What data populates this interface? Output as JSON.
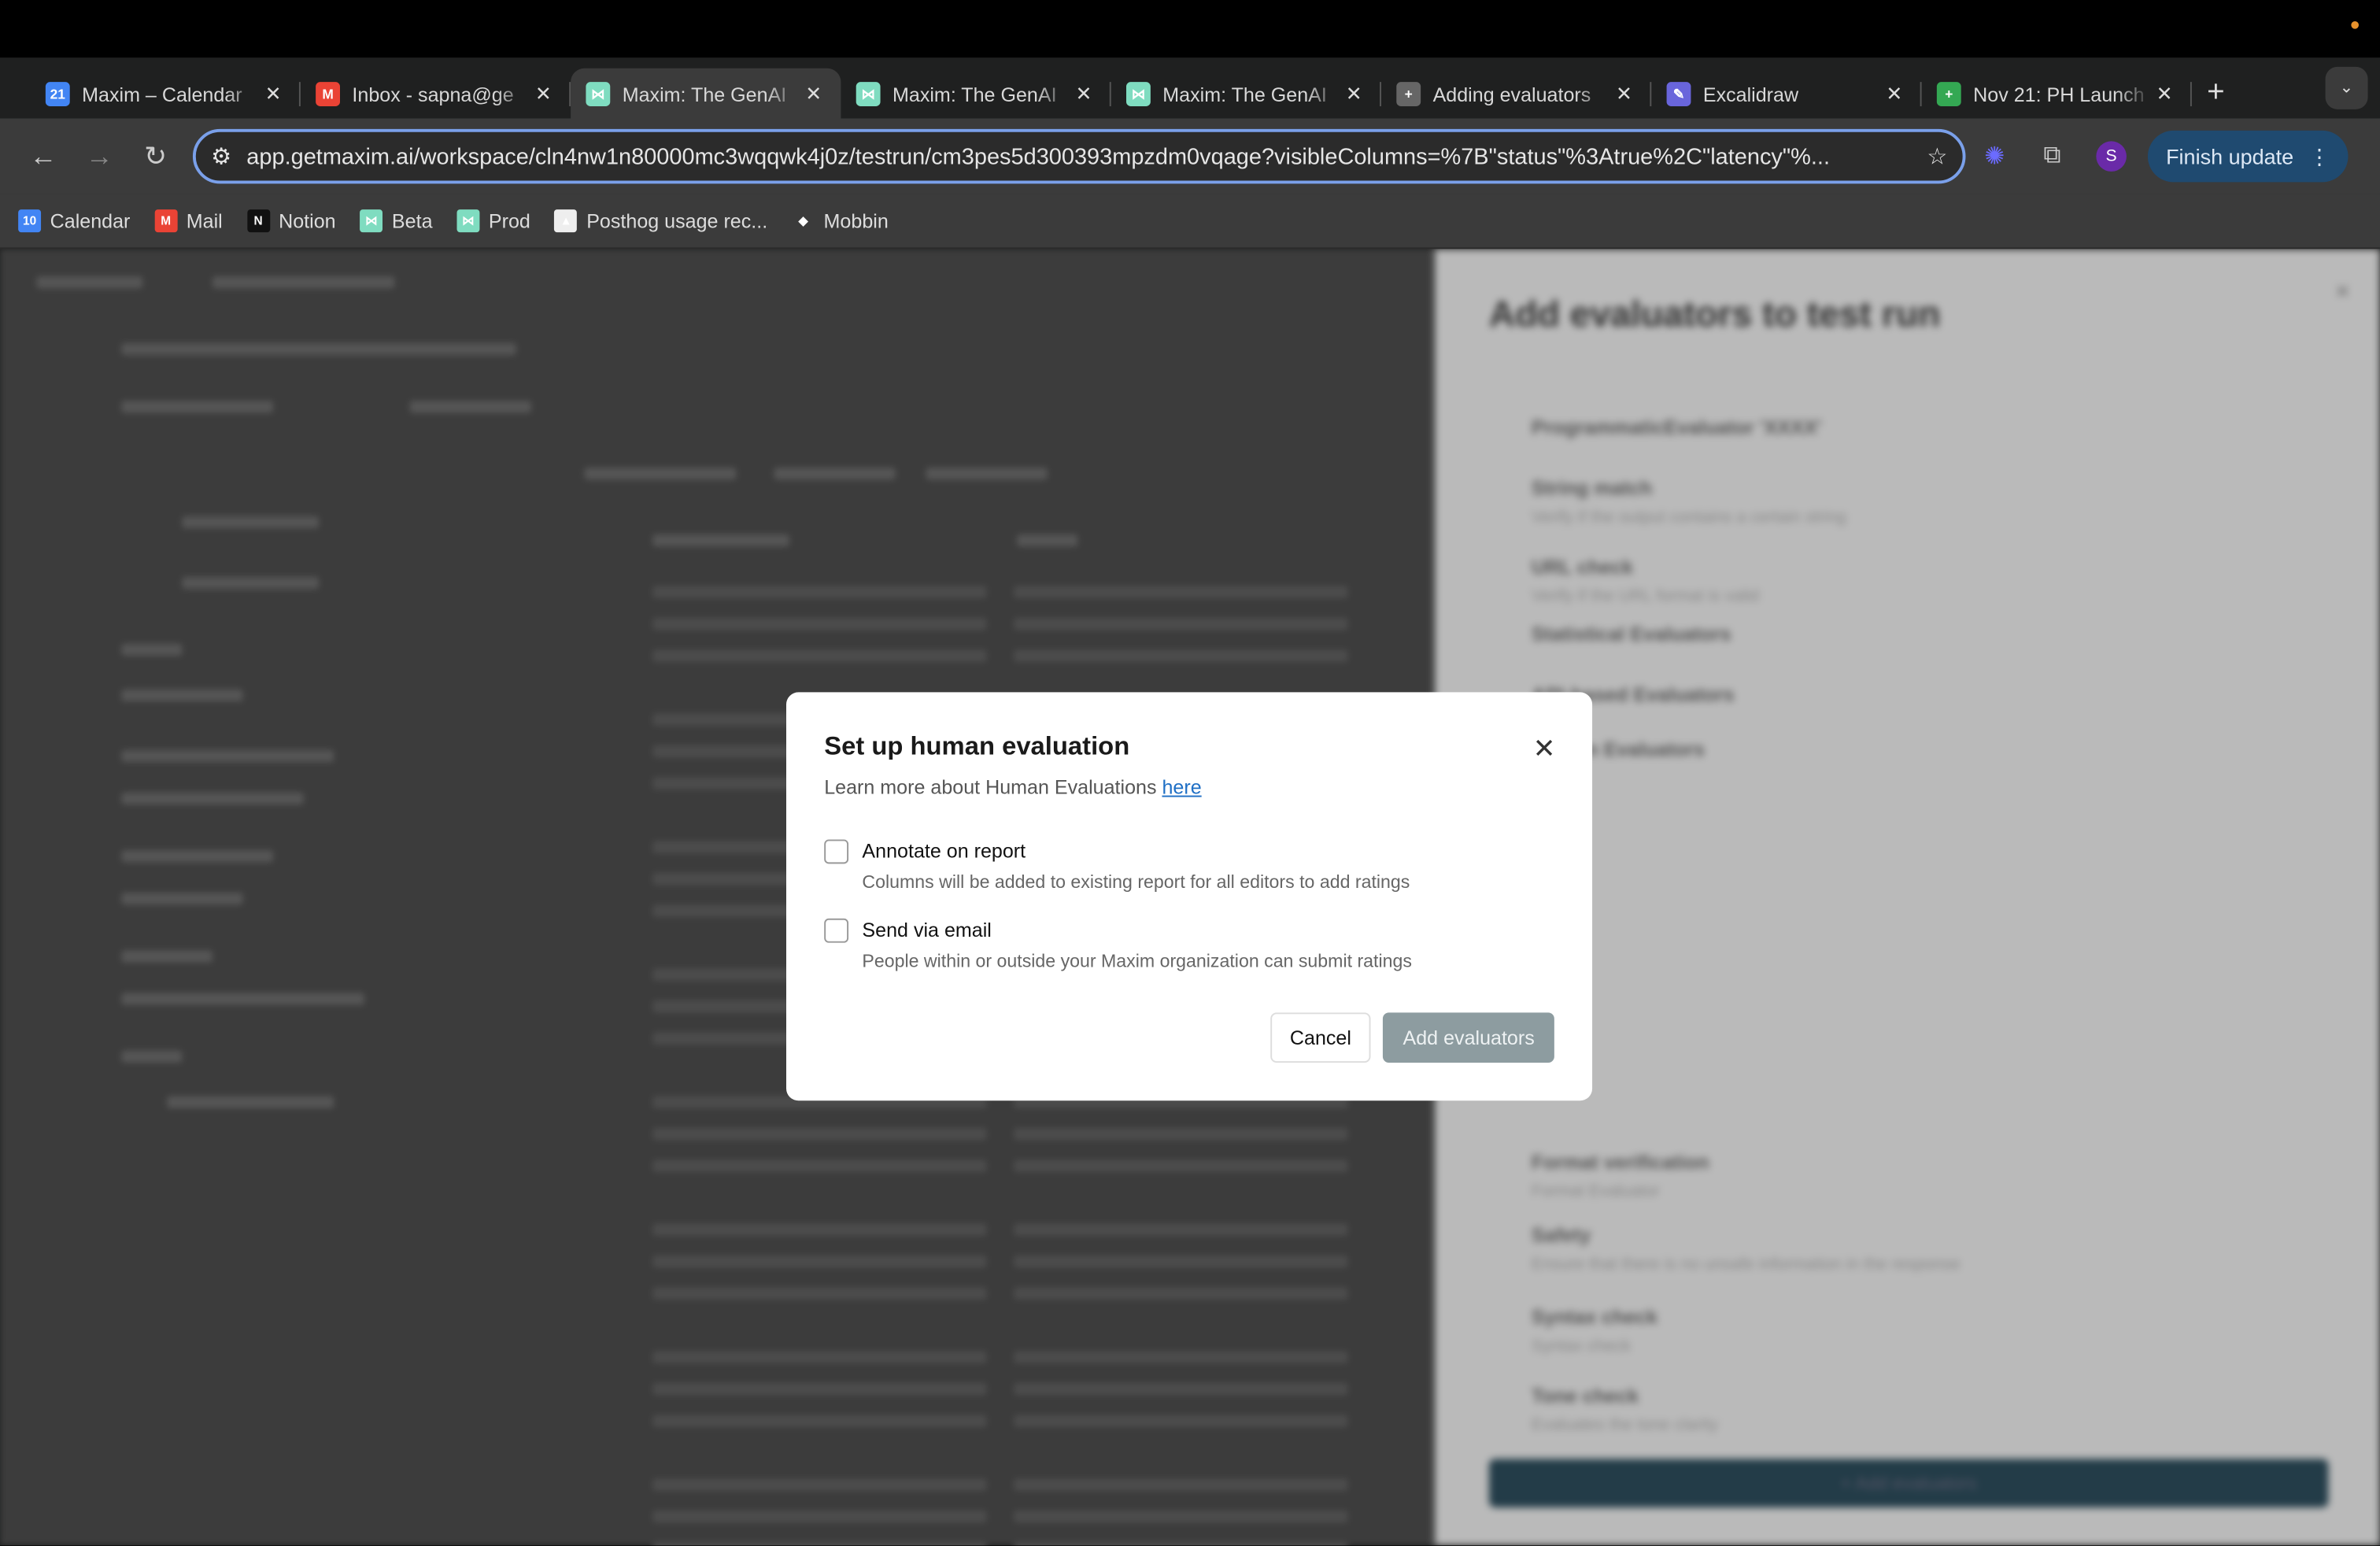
{
  "browser": {
    "tabs": [
      {
        "title": "Maxim – Calendar",
        "icon": "google-calendar-icon",
        "color": "#4285f4",
        "glyph": "21"
      },
      {
        "title": "Inbox - sapna@ge",
        "icon": "gmail-icon",
        "color": "#ea4335",
        "glyph": "M"
      },
      {
        "title": "Maxim: The GenAI",
        "icon": "maxim-icon",
        "color": "#7fdcc0",
        "glyph": "⋈",
        "active": true
      },
      {
        "title": "Maxim: The GenAI",
        "icon": "maxim-icon",
        "color": "#7fdcc0",
        "glyph": "⋈"
      },
      {
        "title": "Maxim: The GenAI",
        "icon": "maxim-icon",
        "color": "#7fdcc0",
        "glyph": "⋈"
      },
      {
        "title": "Adding evaluators",
        "icon": "plus-doc-icon",
        "color": "#666",
        "glyph": "+"
      },
      {
        "title": "Excalidraw",
        "icon": "excalidraw-icon",
        "color": "#6965db",
        "glyph": "✎"
      },
      {
        "title": "Nov 21: PH Launch",
        "icon": "sheets-icon",
        "color": "#34a853",
        "glyph": "+"
      }
    ],
    "url": "app.getmaxim.ai/workspace/cln4nw1n80000mc3wqqwk4j0z/testrun/cm3pes5d300393mpzdm0vqage?visibleColumns=%7B\"status\"%3Atrue%2C\"latency\"%...",
    "profile_initial": "S",
    "finish_update": "Finish update",
    "bookmarks": [
      {
        "label": "Calendar",
        "color": "#4285f4",
        "glyph": "10"
      },
      {
        "label": "Mail",
        "color": "#ea4335",
        "glyph": "M"
      },
      {
        "label": "Notion",
        "color": "#111",
        "glyph": "N"
      },
      {
        "label": "Beta",
        "color": "#7fdcc0",
        "glyph": "⋈"
      },
      {
        "label": "Prod",
        "color": "#7fdcc0",
        "glyph": "⋈"
      },
      {
        "label": "Posthog usage rec...",
        "color": "#eee",
        "glyph": "▲"
      },
      {
        "label": "Mobbin",
        "color": "transparent",
        "glyph": "◆"
      }
    ]
  },
  "side_panel": {
    "title": "Add evaluators to test run",
    "items": [
      {
        "label": "ProgrammaticEvaluator 'XXXX'",
        "desc": ""
      },
      {
        "label": "String match",
        "desc": "Verify if the output contains a certain string"
      },
      {
        "label": "URL check",
        "desc": "Verify if the URL format is valid"
      },
      {
        "label": "Statistical Evaluators",
        "desc": ""
      },
      {
        "label": "API-based Evaluators",
        "desc": ""
      },
      {
        "label": "Human Evaluators",
        "desc": ""
      },
      {
        "label": "Format verification",
        "desc": "Format Evaluator"
      },
      {
        "label": "Safety",
        "desc": "Ensure that there is no unsafe information in the response"
      },
      {
        "label": "Syntax check",
        "desc": "Syntax check"
      },
      {
        "label": "Tone check",
        "desc": "Evaluates the tone clarity"
      }
    ],
    "add_button": "+ Add evaluators"
  },
  "modal": {
    "title": "Set up human evaluation",
    "subtitle": "Learn more about Human Evaluations ",
    "link": "here",
    "options": [
      {
        "label": "Annotate on report",
        "desc": "Columns will be added to existing report for all editors to add ratings",
        "checked": false
      },
      {
        "label": "Send via email",
        "desc": "People within or outside your Maxim organization can submit ratings",
        "checked": false
      }
    ],
    "cancel": "Cancel",
    "submit": "Add evaluators"
  }
}
